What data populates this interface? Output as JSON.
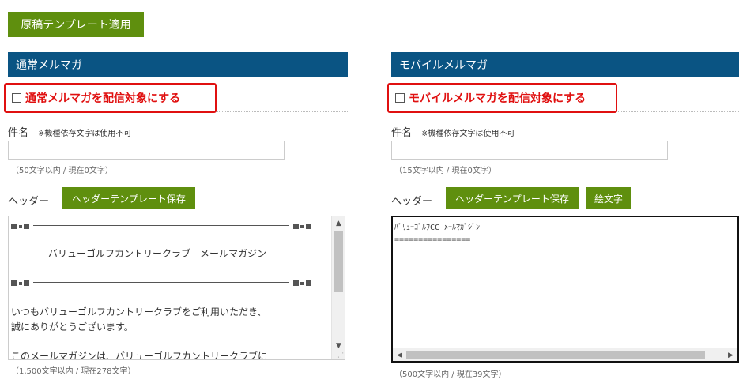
{
  "apply_template_label": "原稿テンプレート適用",
  "normal": {
    "section_title": "通常メルマガ",
    "checkbox_label": "通常メルマガを配信対象にする",
    "subject_label": "件名",
    "subject_note": "※機種依存文字は使用不可",
    "subject_value": "",
    "subject_count": "（50文字以内 / 現在0文字）",
    "header_label": "ヘッダー",
    "header_save_label": "ヘッダーテンプレート保存",
    "editor_lines": [
      "バリューゴルフカントリークラブ　メールマガジン",
      "いつもバリューゴルフカントリークラブをご利用いただき、",
      "誠にありがとうございます。",
      "このメールマガジンは、バリューゴルフカントリークラブに"
    ],
    "body_count": "（1,500文字以内 / 現在278文字）"
  },
  "mobile": {
    "section_title": "モバイルメルマガ",
    "checkbox_label": "モバイルメルマガを配信対象にする",
    "subject_label": "件名",
    "subject_note": "※機種依存文字は使用不可",
    "subject_value": "",
    "subject_count": "（15文字以内 / 現在0文字）",
    "header_label": "ヘッダー",
    "header_save_label": "ヘッダーテンプレート保存",
    "emoji_label": "絵文字",
    "editor_lines": [
      "ﾊﾞﾘｭｰｺﾞﾙﾌCC ﾒｰﾙﾏｶﾞｼﾞﾝ",
      "================"
    ],
    "body_count": "（500文字以内 / 現在39文字）"
  },
  "colors": {
    "accent_green": "#5f8f0e",
    "section_blue": "#0a5483",
    "highlight_red": "#e01010"
  },
  "icons": {
    "checkbox": "checkbox-empty-icon",
    "scroll_up": "scroll-up-arrow-icon",
    "scroll_down": "scroll-down-arrow-icon",
    "scroll_left": "scroll-left-arrow-icon",
    "scroll_right": "scroll-right-arrow-icon",
    "resize": "resize-grip-icon"
  }
}
